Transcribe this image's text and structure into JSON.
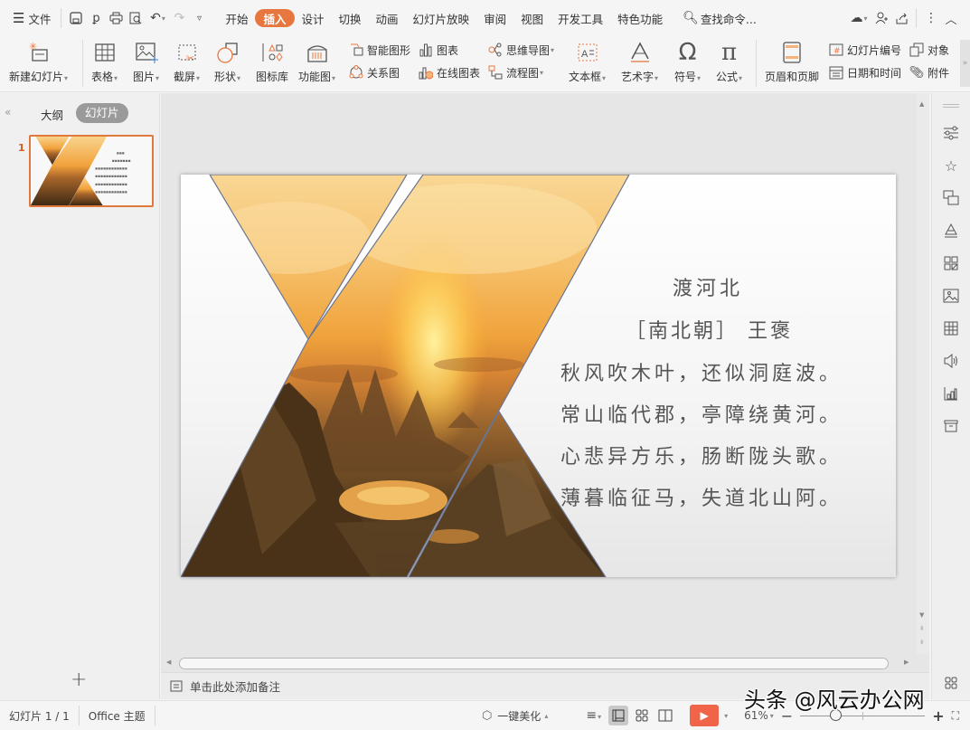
{
  "menubar": {
    "file_label": "文件",
    "tabs": [
      "开始",
      "插入",
      "设计",
      "切换",
      "动画",
      "幻灯片放映",
      "审阅",
      "视图",
      "开发工具",
      "特色功能"
    ],
    "active_tab": "插入",
    "search_label": "查找命令..."
  },
  "ribbon": {
    "new_slide": "新建幻灯片",
    "table": "表格",
    "picture": "图片",
    "screenshot": "截屏",
    "shape": "形状",
    "icon_library": "图标库",
    "function_chart": "功能图",
    "smart_art": "智能图形",
    "relation_chart": "关系图",
    "chart": "图表",
    "online_chart": "在线图表",
    "mind_map": "思维导图",
    "flowchart": "流程图",
    "textbox": "文本框",
    "wordart": "艺术字",
    "symbol": "符号",
    "formula": "公式",
    "header_footer": "页眉和页脚",
    "slide_number": "幻灯片编号",
    "date_time": "日期和时间",
    "object": "对象",
    "attachment": "附件"
  },
  "leftpanel": {
    "tab_outline": "大纲",
    "tab_slides": "幻灯片",
    "slide_number": "1",
    "add_slide": "+"
  },
  "slide": {
    "title": "渡河北",
    "author": "［南北朝］ 王褒",
    "lines": [
      "秋风吹木叶，还似洞庭波。",
      "常山临代郡，亭障绕黄河。",
      "心悲异方乐，肠断陇头歌。",
      "薄暮临征马，失道北山阿。"
    ]
  },
  "notes": {
    "placeholder": "单击此处添加备注"
  },
  "statusbar": {
    "slide_counter": "幻灯片 1 / 1",
    "theme": "Office 主题",
    "beautify": "一键美化",
    "zoom": "61%",
    "zoom_fraction": 0.61
  },
  "watermark": "头条 @风云办公网",
  "colors": {
    "accent": "#e8763f",
    "play": "#f0654a"
  }
}
